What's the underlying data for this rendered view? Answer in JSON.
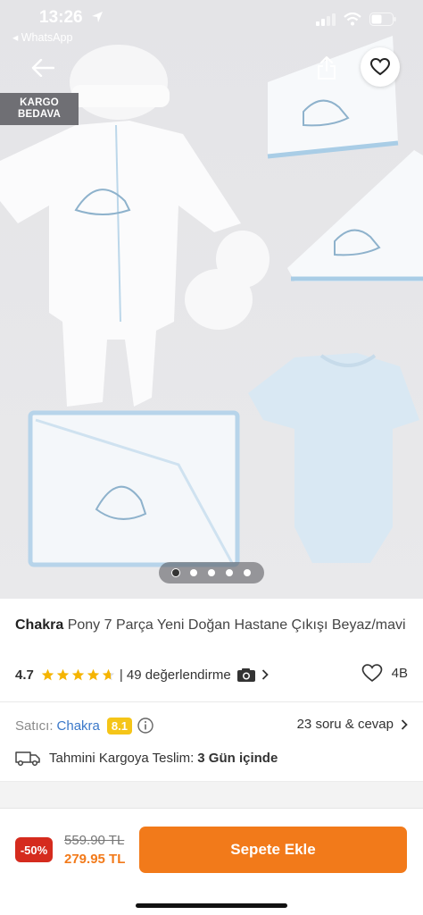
{
  "status": {
    "time": "13:26",
    "back_app": "◂ WhatsApp"
  },
  "badge": {
    "line1": "KARGO",
    "line2": "BEDAVA"
  },
  "gallery": {
    "image_count": 5,
    "active_index": 0
  },
  "product": {
    "brand": "Chakra",
    "name": "Pony 7 Parça Yeni Doğan Hastane Çıkışı Beyaz/mavi",
    "rating": "4.7",
    "stars": 4.7,
    "reviews": "| 49 değerlendirme",
    "favorites": "4B"
  },
  "seller": {
    "label": "Satıcı:",
    "name": "Chakra",
    "score": "8.1",
    "qa": "23 soru & cevap"
  },
  "shipping": {
    "label": "Tahmini Kargoya Teslim:",
    "days": "3 Gün içinde"
  },
  "pricing": {
    "discount": "-50%",
    "old_price": "559.90 TL",
    "new_price": "279.95 TL",
    "cart_label": "Sepete Ekle"
  },
  "colors": {
    "accent": "#f27a1a",
    "discount": "#d52b1e",
    "seller_link": "#3a78c9",
    "score_badge": "#f5c518",
    "star": "#f5b400",
    "badge_bg": "#6f6f74"
  }
}
